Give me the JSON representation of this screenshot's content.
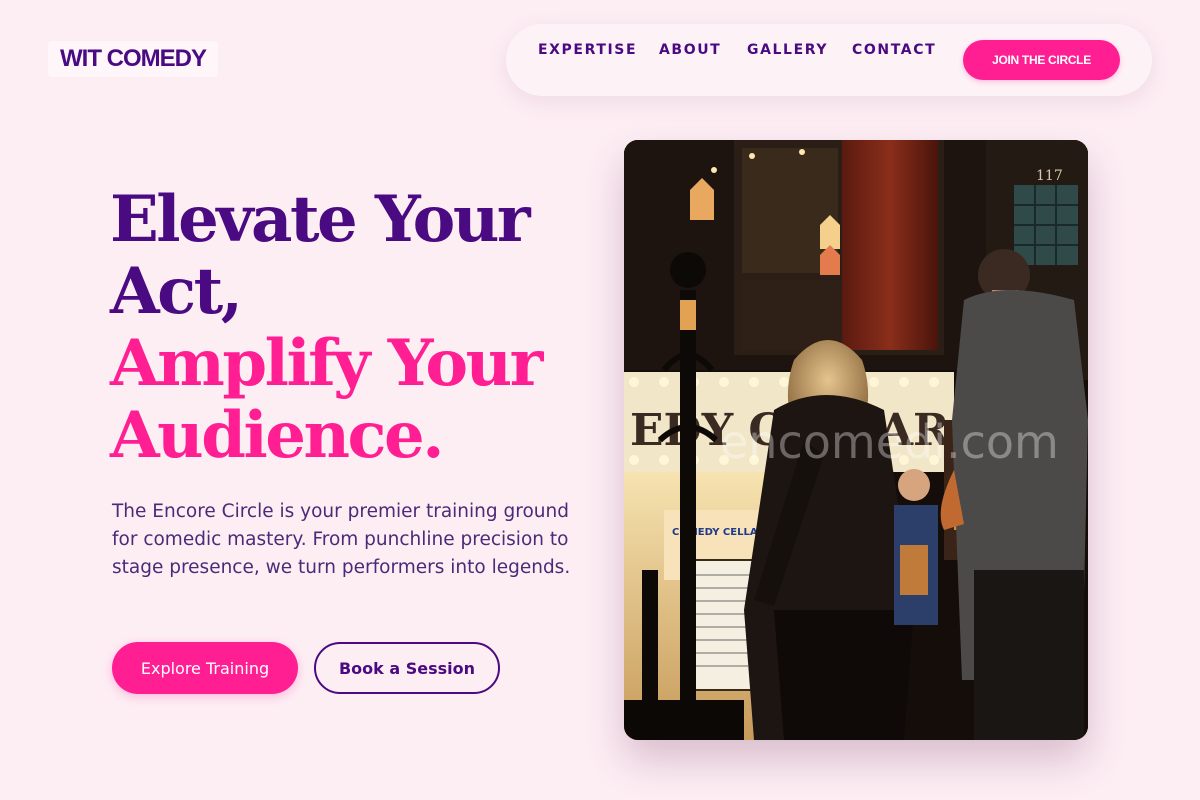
{
  "brand": {
    "logo": "WIT COMEDY"
  },
  "nav": {
    "items": [
      "EXPERTISE",
      "ABOUT",
      "GALLERY",
      "CONTACT"
    ],
    "cta": "JOIN THE CIRCLE"
  },
  "hero": {
    "headline_line1": "Elevate Your",
    "headline_line2": "Act,",
    "headline_line3": "Amplify Your",
    "headline_line4": "Audience.",
    "lead": "The Encore Circle is your premier training ground for comedic mastery. From punchline precision to stage presence, we turn performers into legends.",
    "primary_cta": "Explore Training",
    "secondary_cta": "Book a Session"
  },
  "photo": {
    "door_number": "117",
    "sign_text": "EDY CELLAR",
    "poster_text": "COMEDY CELLAR",
    "watermark": "encomedi.com"
  },
  "colors": {
    "background": "#fdeef4",
    "primary_purple": "#4a0a82",
    "accent_pink": "#ff1f93"
  }
}
